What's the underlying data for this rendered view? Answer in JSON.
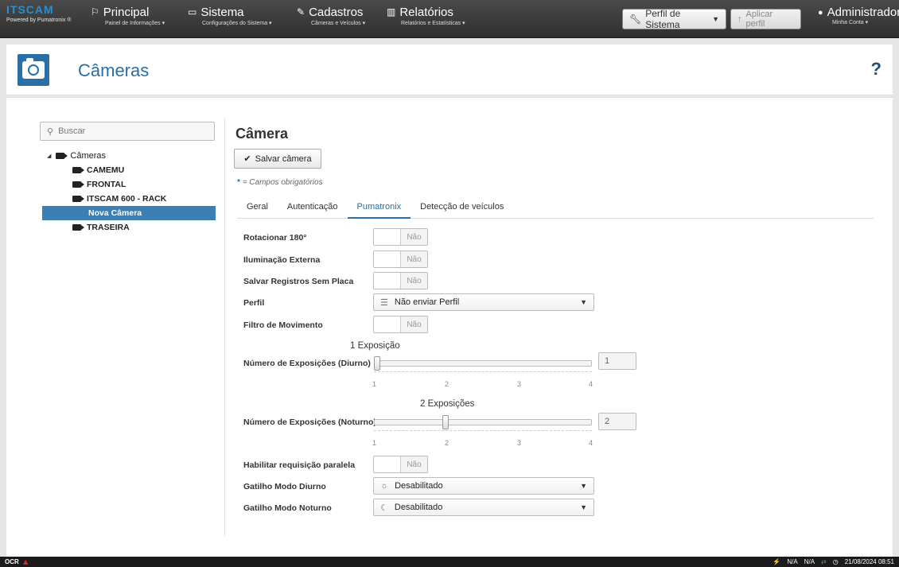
{
  "brand": {
    "logo": "ITSCAM",
    "powered": "Powered by Pumatronix ®"
  },
  "nav": [
    {
      "icon": "flag-icon",
      "glyph": "⚐",
      "title": "Principal",
      "sub": "Painel de Informações ▾"
    },
    {
      "icon": "monitor-icon",
      "glyph": "▭",
      "title": "Sistema",
      "sub": "Configurações do Sistema ▾"
    },
    {
      "icon": "edit-icon",
      "glyph": "✎",
      "title": "Cadastros",
      "sub": "Câmeras e Veículos ▾"
    },
    {
      "icon": "bar-chart-icon",
      "glyph": "▥",
      "title": "Relatórios",
      "sub": "Relatórios e Estatísticas ▾"
    }
  ],
  "profile_select": {
    "value": "Perfil de Sistema"
  },
  "apply_profile": {
    "label": "Aplicar perfil"
  },
  "user": {
    "name": "Administrador",
    "sub": "Minha Conta ▾"
  },
  "page": {
    "title": "Câmeras",
    "help": "?"
  },
  "search": {
    "placeholder": "Buscar"
  },
  "tree": {
    "root": "Câmeras",
    "children": [
      "CAMEMU",
      "FRONTAL",
      "ITSCAM 600 - RACK",
      "Nova Câmera",
      "TRASEIRA"
    ]
  },
  "form": {
    "title": "Câmera",
    "save_label": "Salvar câmera",
    "required_star": "*",
    "required_text": "= Campos obrigatórios",
    "tabs": [
      "Geral",
      "Autenticação",
      "Pumatronix",
      "Detecção de veículos"
    ]
  },
  "fields": {
    "rotate": {
      "label": "Rotacionar 180°",
      "value": "Não"
    },
    "external_light": {
      "label": "Iluminação Externa",
      "value": "Não"
    },
    "save_no_plate": {
      "label": "Salvar Registros Sem Placa",
      "value": "Não"
    },
    "profile": {
      "label": "Perfil",
      "value": "Não enviar Perfil"
    },
    "motion_filter": {
      "label": "Filtro de Movimento",
      "value": "Não"
    },
    "exp_day": {
      "label": "Número de Exposições (Diurno)",
      "caption": "1 Exposição",
      "value": "1",
      "min": 1,
      "max": 4,
      "level": 1
    },
    "exp_night": {
      "label": "Número de Exposições (Noturno)",
      "caption": "2 Exposições",
      "value": "2",
      "min": 1,
      "max": 4,
      "level": 2
    },
    "parallel": {
      "label": "Habilitar requisição paralela",
      "value": "Não"
    },
    "trigger_day": {
      "label": "Gatilho Modo Diurno",
      "value": "Desabilitado"
    },
    "trigger_night": {
      "label": "Gatilho Modo Noturno",
      "value": "Desabilitado"
    }
  },
  "ticks": [
    "1",
    "2",
    "3",
    "4"
  ],
  "taskbar": {
    "left": "OCR",
    "status1": "N/A",
    "status2": "N/A",
    "clock": "21/08/2024 08:51"
  }
}
